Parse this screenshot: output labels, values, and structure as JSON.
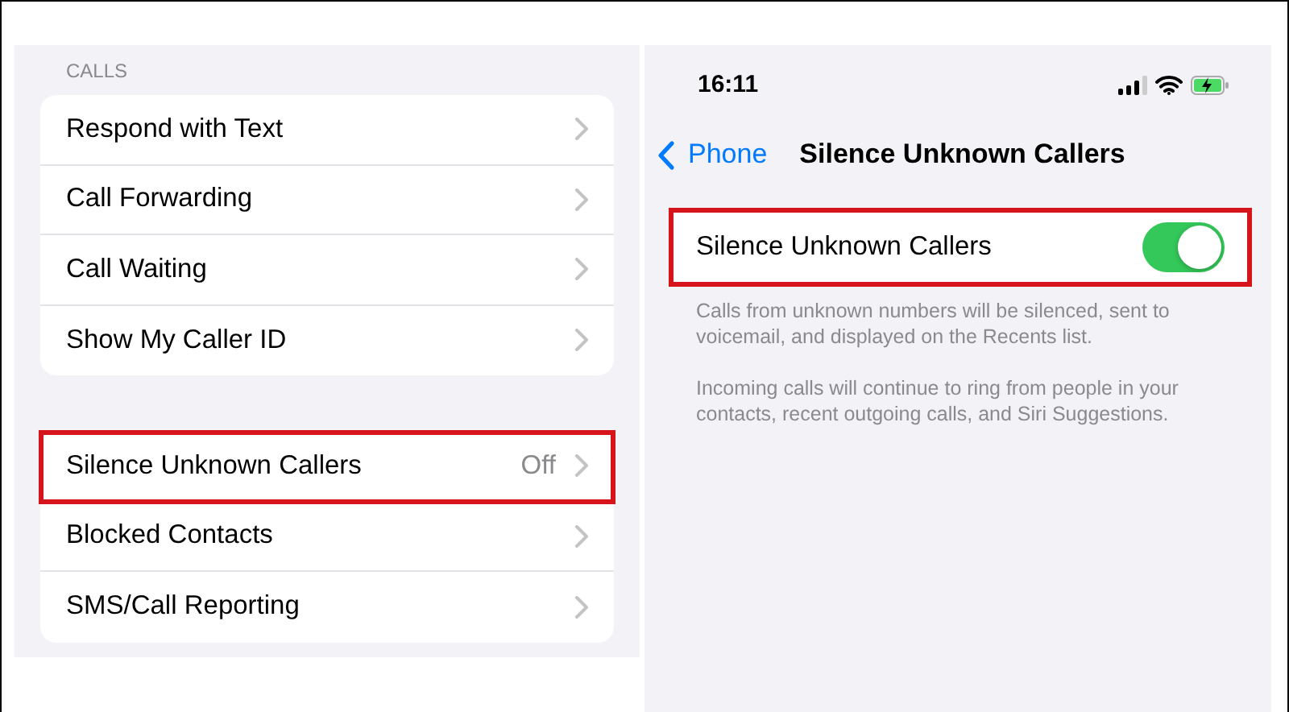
{
  "left_screen": {
    "section_header": "CALLS",
    "groups": [
      {
        "rows": [
          {
            "label": "Respond with Text",
            "highlighted": false
          },
          {
            "label": "Call Forwarding",
            "highlighted": false
          },
          {
            "label": "Call Waiting",
            "highlighted": false
          },
          {
            "label": "Show My Caller ID",
            "highlighted": false
          }
        ]
      },
      {
        "rows": [
          {
            "label": "Silence Unknown Callers",
            "value": "Off",
            "highlighted": true
          },
          {
            "label": "Blocked Contacts",
            "highlighted": false
          },
          {
            "label": "SMS/Call Reporting",
            "highlighted": false
          }
        ]
      }
    ]
  },
  "right_screen": {
    "status_bar": {
      "time": "16:11"
    },
    "nav": {
      "back_label": "Phone",
      "title": "Silence Unknown Callers"
    },
    "toggle_row": {
      "label": "Silence Unknown Callers",
      "on": true,
      "highlighted": true
    },
    "footer_notes": [
      "Calls from unknown numbers will be silenced, sent to voicemail, and displayed on the Recents list.",
      "Incoming calls will continue to ring from people in your contacts, recent outgoing calls, and Siri Suggestions."
    ]
  }
}
